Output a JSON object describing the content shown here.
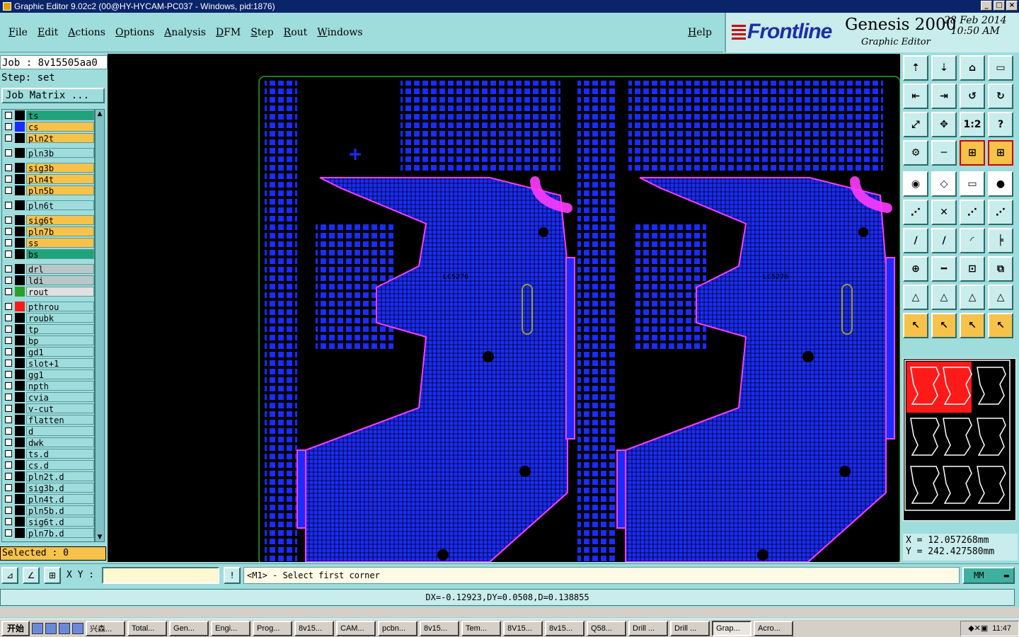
{
  "window": {
    "title": "Graphic Editor 9.02c2 (00@HY-HYCAM-PC037 - Windows, pid:1876)"
  },
  "menu": {
    "items": [
      "File",
      "Edit",
      "Actions",
      "Options",
      "Analysis",
      "DFM",
      "Step",
      "Rout",
      "Windows"
    ],
    "help": "Help"
  },
  "brand": {
    "logo": "Frontline",
    "product": "Genesis 2000",
    "subtitle": "Graphic Editor",
    "date": "28 Feb 2014",
    "time": "10:50 AM"
  },
  "job": {
    "job_label": "Job : 8v15505aa0",
    "step_label": "Step: set",
    "matrix_button": "Job Matrix ..."
  },
  "layers": [
    {
      "name": "ts",
      "color": "#1fa37a",
      "swatch": "#000"
    },
    {
      "name": "cs",
      "color": "#f7c24a",
      "swatch": "#1a2cff"
    },
    {
      "name": "pln2t",
      "color": "#f7c24a",
      "swatch": "#000"
    },
    {
      "gap": true
    },
    {
      "name": "pln3b",
      "color": "#9fdcdc",
      "swatch": "#000"
    },
    {
      "gap": true
    },
    {
      "name": "sig3b",
      "color": "#f7c24a",
      "swatch": "#000"
    },
    {
      "name": "pln4t",
      "color": "#f7c24a",
      "swatch": "#000"
    },
    {
      "name": "pln5b",
      "color": "#f7c24a",
      "swatch": "#000"
    },
    {
      "gap": true
    },
    {
      "name": "pln6t",
      "color": "#9fdcdc",
      "swatch": "#000"
    },
    {
      "gap": true
    },
    {
      "name": "sig6t",
      "color": "#f7c24a",
      "swatch": "#000"
    },
    {
      "name": "pln7b",
      "color": "#f7c24a",
      "swatch": "#000"
    },
    {
      "name": "ss",
      "color": "#f7c24a",
      "swatch": "#000"
    },
    {
      "name": "bs",
      "color": "#1fa37a",
      "swatch": "#000"
    },
    {
      "gap": true
    },
    {
      "name": "drl",
      "color": "#b8c8c8",
      "swatch": "#000"
    },
    {
      "name": "ldi",
      "color": "#b8c8c8",
      "swatch": "#000"
    },
    {
      "name": "rout",
      "color": "#e0e0e0",
      "swatch": "#2aa02a"
    },
    {
      "gap": true
    },
    {
      "name": "pthrou",
      "color": "#9fdcdc",
      "swatch": "#ff1a1a"
    },
    {
      "name": "roubk",
      "color": "#9fdcdc",
      "swatch": "#000"
    },
    {
      "name": "tp",
      "color": "#9fdcdc",
      "swatch": "#000"
    },
    {
      "name": "bp",
      "color": "#9fdcdc",
      "swatch": "#000"
    },
    {
      "name": "gd1",
      "color": "#9fdcdc",
      "swatch": "#000"
    },
    {
      "name": "slot+1",
      "color": "#9fdcdc",
      "swatch": "#000"
    },
    {
      "name": "gg1",
      "color": "#9fdcdc",
      "swatch": "#000"
    },
    {
      "name": "npth",
      "color": "#9fdcdc",
      "swatch": "#000"
    },
    {
      "name": "cvia",
      "color": "#9fdcdc",
      "swatch": "#000"
    },
    {
      "name": "v-cut",
      "color": "#9fdcdc",
      "swatch": "#000"
    },
    {
      "name": "flatten",
      "color": "#9fdcdc",
      "swatch": "#000"
    },
    {
      "name": "d",
      "color": "#9fdcdc",
      "swatch": "#000"
    },
    {
      "name": "dwk",
      "color": "#9fdcdc",
      "swatch": "#000"
    },
    {
      "name": "ts.d",
      "color": "#9fdcdc",
      "swatch": "#000"
    },
    {
      "name": "cs.d",
      "color": "#9fdcdc",
      "swatch": "#000"
    },
    {
      "name": "pln2t.d",
      "color": "#9fdcdc",
      "swatch": "#000"
    },
    {
      "name": "sig3b.d",
      "color": "#9fdcdc",
      "swatch": "#000"
    },
    {
      "name": "pln4t.d",
      "color": "#9fdcdc",
      "swatch": "#000"
    },
    {
      "name": "pln5b.d",
      "color": "#9fdcdc",
      "swatch": "#000"
    },
    {
      "name": "sig6t.d",
      "color": "#9fdcdc",
      "swatch": "#000"
    },
    {
      "name": "pln7b.d",
      "color": "#9fdcdc",
      "swatch": "#000"
    }
  ],
  "selected": "Selected : 0",
  "canvas": {
    "component_label_left": "LC5276",
    "component_label_right": "LC5276"
  },
  "tools": {
    "icons": [
      "open-top-icon",
      "save-icon",
      "home-icon",
      "window-icon",
      "zoom-left-icon",
      "zoom-right-icon",
      "undo-view-icon",
      "redraw-icon",
      "fit-icon",
      "center-icon",
      "scale-1to2-icon",
      "help-icon",
      "settings-icon",
      "measure-icon",
      "select-layer-icon",
      "select-layer2-icon",
      "camera-icon",
      "polygon-icon",
      "ruler-icon",
      "pad-icon",
      "net-icon",
      "snap-icon",
      "point-icon",
      "point2-icon",
      "line-icon",
      "line2-icon",
      "arc-icon",
      "flatten-icon",
      "pad-add-icon",
      "minus-icon",
      "chain-icon",
      "shapes-icon",
      "triangle-icon",
      "triangle2-icon",
      "triangle3-icon",
      "triangle4-icon",
      "pointer-icon",
      "pointer2-icon",
      "pointer3-icon",
      "pointer4-icon"
    ],
    "glyphs": [
      "⇡",
      "⇣",
      "⌂",
      "▭",
      "⇤",
      "⇥",
      "↺",
      "↻",
      "⤢",
      "✥",
      "1:2",
      "?",
      "⚙",
      "─",
      "⊞",
      "⊞",
      "◉",
      "◇",
      "▭",
      "●",
      "⋰",
      "✕",
      "⋰",
      "⋰",
      "∕",
      "∕",
      "◜",
      "╞",
      "⊕",
      "━",
      "⊡",
      "⧉",
      "△",
      "△",
      "△",
      "△",
      "↖",
      "↖",
      "↖",
      "↖"
    ]
  },
  "coords": {
    "x": "X = 12.057268mm",
    "y": "Y = 242.427580mm"
  },
  "command": {
    "xy_label": "X Y :",
    "xy_value": "",
    "prompt": "<M1> - Select first corner",
    "units": "MM"
  },
  "status": {
    "text": "DX=-0.12923,DY=0.0508,D=0.138855"
  },
  "taskbar": {
    "start": "开始",
    "tasks": [
      "兴森...",
      "Total...",
      "Gen...",
      "Engi...",
      "Prog...",
      "8v15...",
      "CAM...",
      "pcbn...",
      "8v15...",
      "Tem...",
      "8V15...",
      "8v15...",
      "Q58...",
      "Drill ...",
      "Drill ...",
      "Grap...",
      "Acro..."
    ],
    "active": 15,
    "clock": "11:47"
  }
}
